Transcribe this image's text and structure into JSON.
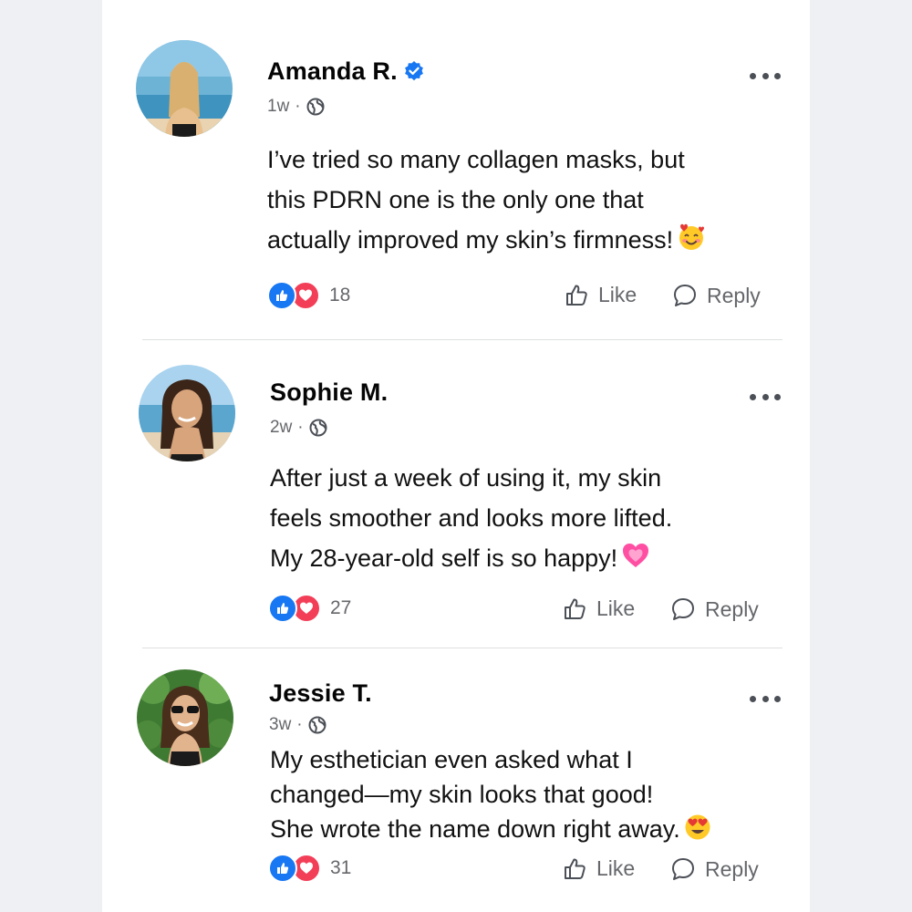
{
  "comments": [
    {
      "author": "Amanda R.",
      "verified": true,
      "time": "1w",
      "body": [
        "I’ve tried so many collagen masks, but",
        "this PDRN one is the only one that",
        "actually improved my skin’s firmness!"
      ],
      "emoji": "smiling-face-with-hearts",
      "reaction_count": "18",
      "like_label": "Like",
      "reply_label": "Reply"
    },
    {
      "author": "Sophie M.",
      "verified": false,
      "time": "2w",
      "body": [
        "After just a week of using it, my skin",
        "feels smoother and looks more lifted.",
        "My 28-year-old self is so happy!"
      ],
      "emoji": "growing-heart",
      "reaction_count": "27",
      "like_label": "Like",
      "reply_label": "Reply"
    },
    {
      "author": "Jessie T.",
      "verified": false,
      "time": "3w",
      "body": [
        "My esthetician even asked what I",
        "changed—my skin looks that good!",
        "She wrote the name down right away."
      ],
      "emoji": "heart-eyes",
      "reaction_count": "31",
      "like_label": "Like",
      "reply_label": "Reply"
    }
  ],
  "colors": {
    "like_blue": "#1877f2",
    "love_red": "#f33e58",
    "meta_gray": "#65676b",
    "verified_blue": "#1877f2"
  }
}
